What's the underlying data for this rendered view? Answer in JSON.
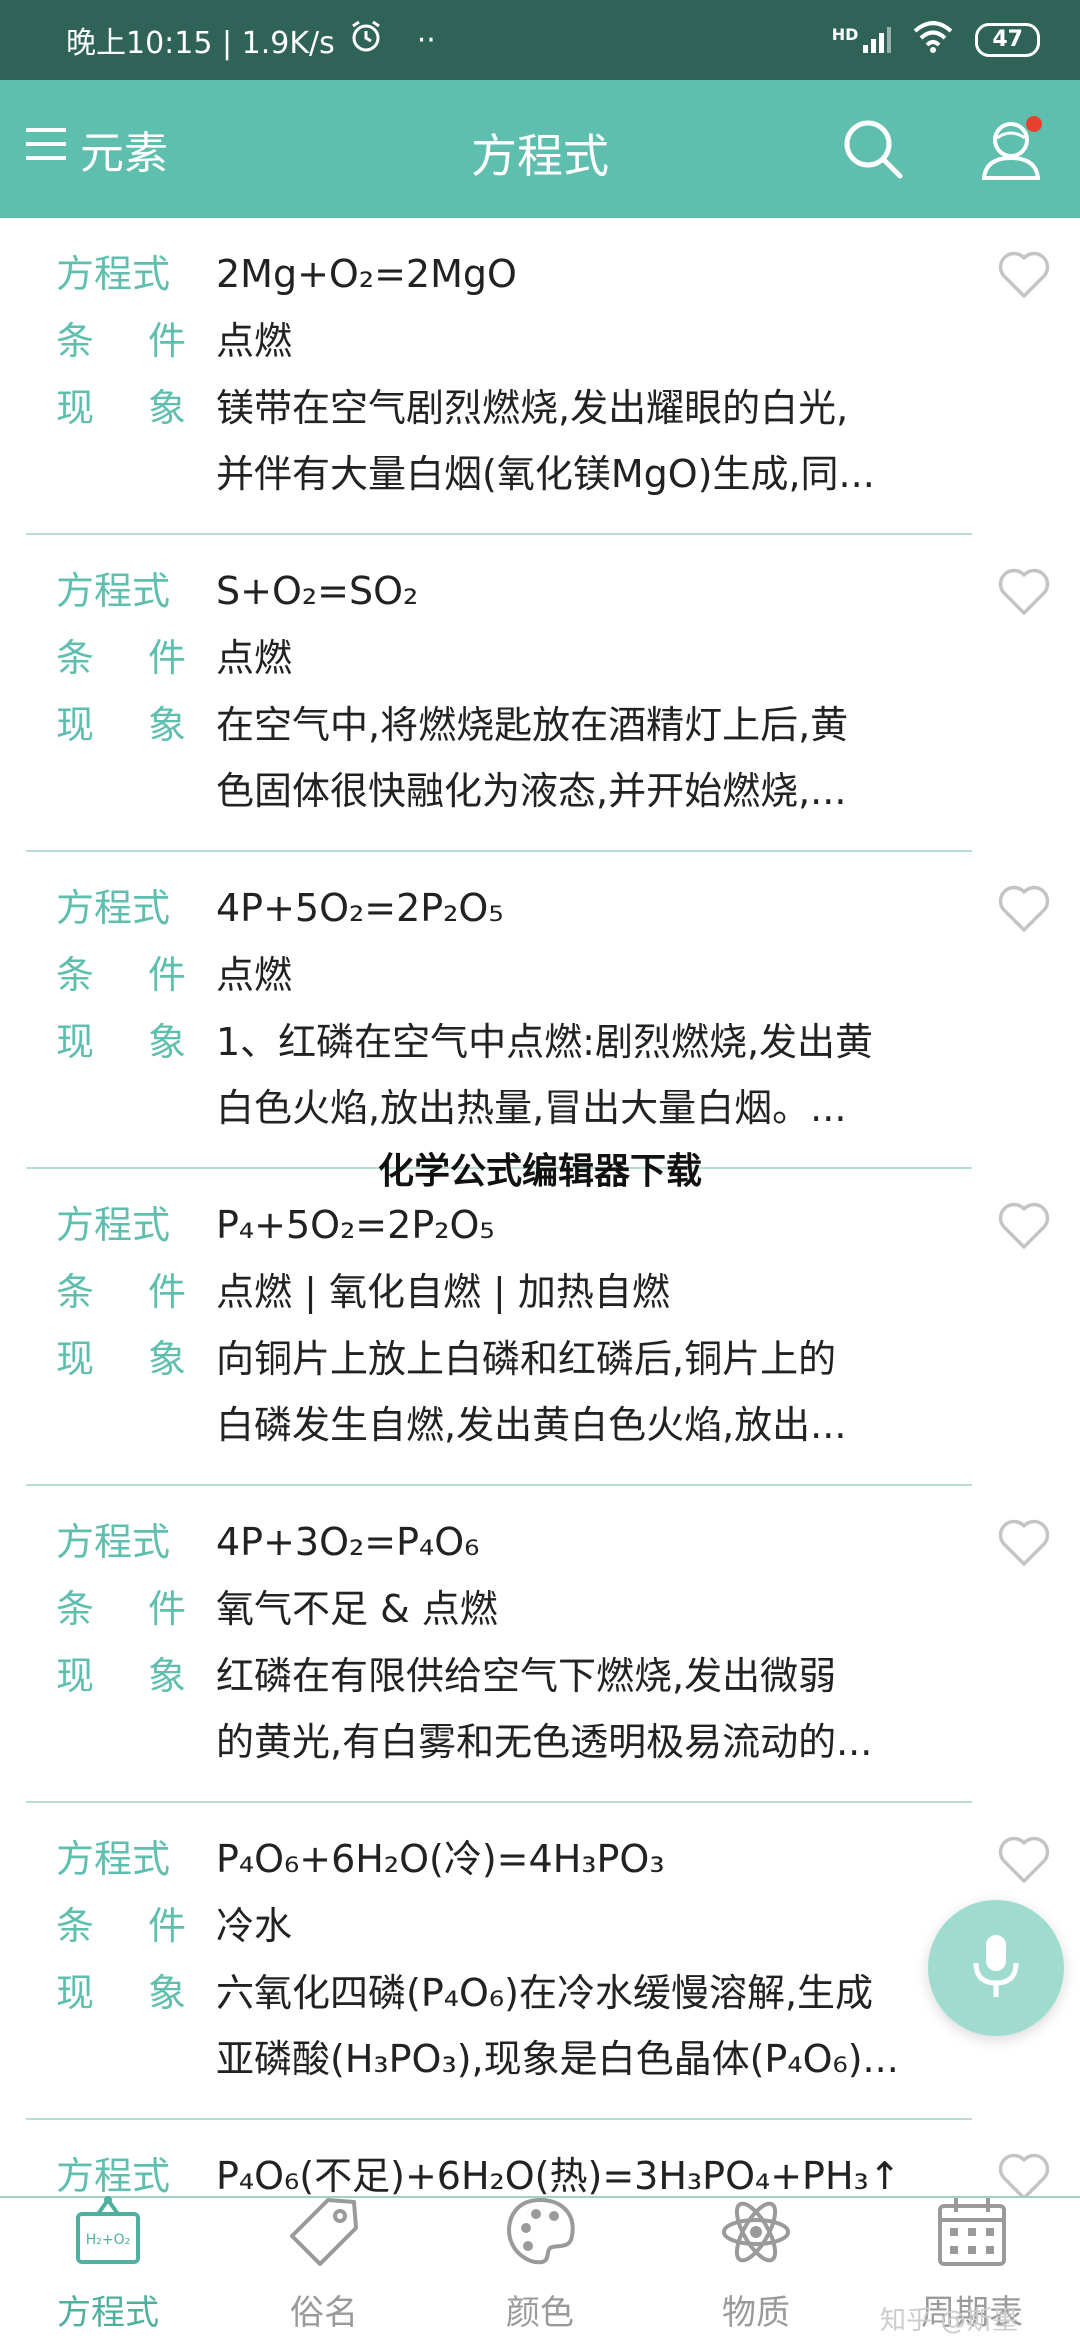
{
  "status_bar": {
    "time_speed": "晚上10:15 | 1.9K/s",
    "dots": "··",
    "network": "HD",
    "battery": "47"
  },
  "app_bar": {
    "menu_label": "元素",
    "title": "方程式"
  },
  "labels": {
    "equation": "方程式",
    "condition_a": "条",
    "condition_b": "件",
    "phenomenon_a": "现",
    "phenomenon_b": "象"
  },
  "entries": [
    {
      "equation": "2Mg+O₂=2MgO",
      "condition": "点燃",
      "phen1": "镁带在空气剧烈燃烧,发出耀眼的白光,",
      "phen2": "并伴有大量白烟(氧化镁MgO)生成,同..."
    },
    {
      "equation": "S+O₂=SO₂",
      "condition": "点燃",
      "phen1": "在空气中,将燃烧匙放在酒精灯上后,黄",
      "phen2": "色固体很快融化为液态,并开始燃烧,..."
    },
    {
      "equation": "4P+5O₂=2P₂O₅",
      "condition": "点燃",
      "phen1": "1、红磷在空气中点燃:剧烈燃烧,发出黄",
      "phen2": "白色火焰,放出热量,冒出大量白烟。..."
    },
    {
      "equation": "P₄+5O₂=2P₂O₅",
      "condition": "点燃 | 氧化自燃 | 加热自燃",
      "phen1": "向铜片上放上白磷和红磷后,铜片上的",
      "phen2": "白磷发生自燃,发出黄白色火焰,放出..."
    },
    {
      "equation": "4P+3O₂=P₄O₆",
      "condition": "氧气不足 & 点燃",
      "phen1": "红磷在有限供给空气下燃烧,发出微弱",
      "phen2": "的黄光,有白雾和无色透明极易流动的..."
    },
    {
      "equation": "P₄O₆+6H₂O(冷)=4H₃PO₃",
      "condition": "冷水",
      "phen1": "六氧化四磷(P₄O₆)在冷水缓慢溶解,生成",
      "phen2": "亚磷酸(H₃PO₃),现象是白色晶体(P₄O₆)..."
    },
    {
      "equation": "P₄O₆(不足)+6H₂O(热)=3H₃PO₄+PH₃↑",
      "condition": "",
      "phen1": "",
      "phen2": ""
    }
  ],
  "watermark": "化学公式编辑器下载",
  "bottom_nav": {
    "tabs": [
      "方程式",
      "俗名",
      "颜色",
      "物质",
      "周期表"
    ],
    "active_index": 0,
    "h2o2_icon_text": "H₂+O₂"
  },
  "corner_watermark": "知乎 @斯墨",
  "colors": {
    "status_bar": "#2f6357",
    "app_bar": "#5fbfae",
    "label": "#5fbfae",
    "divider": "#b8ddd6"
  }
}
